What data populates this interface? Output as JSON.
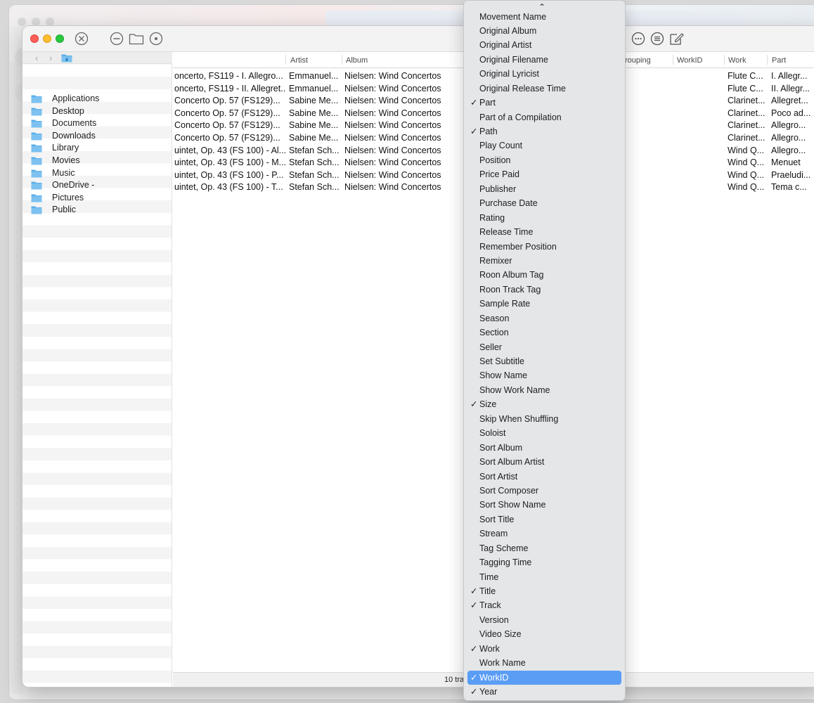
{
  "sidebar": {
    "items": [
      {
        "label": "Applications"
      },
      {
        "label": "Desktop"
      },
      {
        "label": "Documents"
      },
      {
        "label": "Downloads"
      },
      {
        "label": "Library"
      },
      {
        "label": "Movies"
      },
      {
        "label": "Music"
      },
      {
        "label": "OneDrive -"
      },
      {
        "label": "Pictures"
      },
      {
        "label": "Public"
      }
    ]
  },
  "table": {
    "headers": {
      "artist": "Artist",
      "album": "Album",
      "grouping": "rouping",
      "workid": "WorkID",
      "work": "Work",
      "part": "Part"
    },
    "rows": [
      {
        "title": "oncerto, FS119 - I. Allegro...",
        "artist": "Emmanuel...",
        "album": "Nielsen: Wind Concertos",
        "work": "Flute C...",
        "part": "I. Allegr..."
      },
      {
        "title": "oncerto, FS119 - II. Allegret...",
        "artist": "Emmanuel...",
        "album": "Nielsen: Wind Concertos",
        "work": "Flute C...",
        "part": "II. Allegr..."
      },
      {
        "title": "Concerto Op. 57 (FS129)...",
        "artist": "Sabine Me...",
        "album": "Nielsen: Wind Concertos",
        "work": "Clarinet...",
        "part": "Allegret..."
      },
      {
        "title": "Concerto Op. 57 (FS129)...",
        "artist": "Sabine Me...",
        "album": "Nielsen: Wind Concertos",
        "work": "Clarinet...",
        "part": "Poco ad..."
      },
      {
        "title": "Concerto Op. 57 (FS129)...",
        "artist": "Sabine Me...",
        "album": "Nielsen: Wind Concertos",
        "work": "Clarinet...",
        "part": "Allegro..."
      },
      {
        "title": "Concerto Op. 57 (FS129)...",
        "artist": "Sabine Me...",
        "album": "Nielsen: Wind Concertos",
        "work": "Clarinet...",
        "part": "Allegro..."
      },
      {
        "title": "uintet, Op. 43 (FS 100) - Al...",
        "artist": "Stefan Sch...",
        "album": "Nielsen: Wind Concertos",
        "work": "Wind Q...",
        "part": "Allegro..."
      },
      {
        "title": "uintet, Op. 43 (FS 100) - M...",
        "artist": "Stefan Sch...",
        "album": "Nielsen: Wind Concertos",
        "work": "Wind Q...",
        "part": "Menuet"
      },
      {
        "title": "uintet, Op. 43 (FS 100) - P...",
        "artist": "Stefan Sch...",
        "album": "Nielsen: Wind Concertos",
        "work": "Wind Q...",
        "part": "Praeludi..."
      },
      {
        "title": "uintet, Op. 43 (FS 100) - T...",
        "artist": "Stefan Sch...",
        "album": "Nielsen: Wind Concertos",
        "work": "Wind Q...",
        "part": "Tema c..."
      }
    ]
  },
  "status": {
    "text": "10 tra"
  },
  "menu": {
    "scroll_up": "⌃",
    "items": [
      {
        "label": "Movement Name",
        "checked": false
      },
      {
        "label": "Original Album",
        "checked": false
      },
      {
        "label": "Original Artist",
        "checked": false
      },
      {
        "label": "Original Filename",
        "checked": false
      },
      {
        "label": "Original Lyricist",
        "checked": false
      },
      {
        "label": "Original Release Time",
        "checked": false
      },
      {
        "label": "Part",
        "checked": true
      },
      {
        "label": "Part of a Compilation",
        "checked": false
      },
      {
        "label": "Path",
        "checked": true
      },
      {
        "label": "Play Count",
        "checked": false
      },
      {
        "label": "Position",
        "checked": false
      },
      {
        "label": "Price Paid",
        "checked": false
      },
      {
        "label": "Publisher",
        "checked": false
      },
      {
        "label": "Purchase Date",
        "checked": false
      },
      {
        "label": "Rating",
        "checked": false
      },
      {
        "label": "Release Time",
        "checked": false
      },
      {
        "label": "Remember Position",
        "checked": false
      },
      {
        "label": "Remixer",
        "checked": false
      },
      {
        "label": "Roon Album Tag",
        "checked": false
      },
      {
        "label": "Roon Track Tag",
        "checked": false
      },
      {
        "label": "Sample Rate",
        "checked": false
      },
      {
        "label": "Season",
        "checked": false
      },
      {
        "label": "Section",
        "checked": false
      },
      {
        "label": "Seller",
        "checked": false
      },
      {
        "label": "Set Subtitle",
        "checked": false
      },
      {
        "label": "Show Name",
        "checked": false
      },
      {
        "label": "Show Work Name",
        "checked": false
      },
      {
        "label": "Size",
        "checked": true
      },
      {
        "label": "Skip When Shuffling",
        "checked": false
      },
      {
        "label": "Soloist",
        "checked": false
      },
      {
        "label": "Sort Album",
        "checked": false
      },
      {
        "label": "Sort Album Artist",
        "checked": false
      },
      {
        "label": "Sort Artist",
        "checked": false
      },
      {
        "label": "Sort Composer",
        "checked": false
      },
      {
        "label": "Sort Show Name",
        "checked": false
      },
      {
        "label": "Sort Title",
        "checked": false
      },
      {
        "label": "Stream",
        "checked": false
      },
      {
        "label": "Tag Scheme",
        "checked": false
      },
      {
        "label": "Tagging Time",
        "checked": false
      },
      {
        "label": "Time",
        "checked": false
      },
      {
        "label": "Title",
        "checked": true
      },
      {
        "label": "Track",
        "checked": true
      },
      {
        "label": "Version",
        "checked": false
      },
      {
        "label": "Video Size",
        "checked": false
      },
      {
        "label": "Work",
        "checked": true
      },
      {
        "label": "Work Name",
        "checked": false
      },
      {
        "label": "WorkID",
        "checked": true,
        "selected": true
      },
      {
        "label": "Year",
        "checked": true
      }
    ]
  },
  "colors": {
    "folder": "#5aaee8",
    "selection": "#5a9df5"
  }
}
